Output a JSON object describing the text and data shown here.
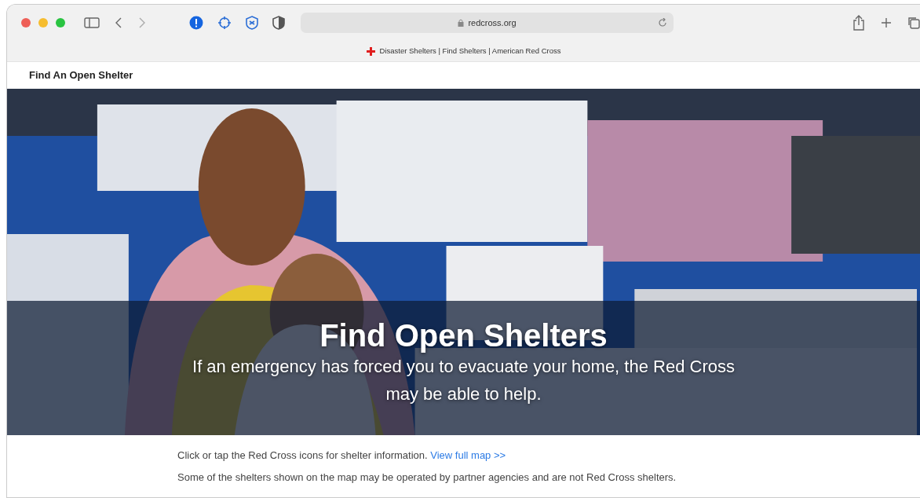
{
  "browser": {
    "address": "redcross.org",
    "tab_title": "Disaster Shelters | Find Shelters | American Red Cross"
  },
  "page": {
    "header": "Find An Open Shelter",
    "hero": {
      "kind": "picture",
      "title": "Find Open Shelters",
      "subtitle": "If an emergency has forced you to evacuate your home, the Red Cross may be able to help."
    },
    "info": {
      "text": "Click or tap the Red Cross icons for shelter information.",
      "link": "View full map >>"
    },
    "note": "Some of the shelters shown on the map may be operated by partner agencies and are not Red Cross shelters."
  }
}
